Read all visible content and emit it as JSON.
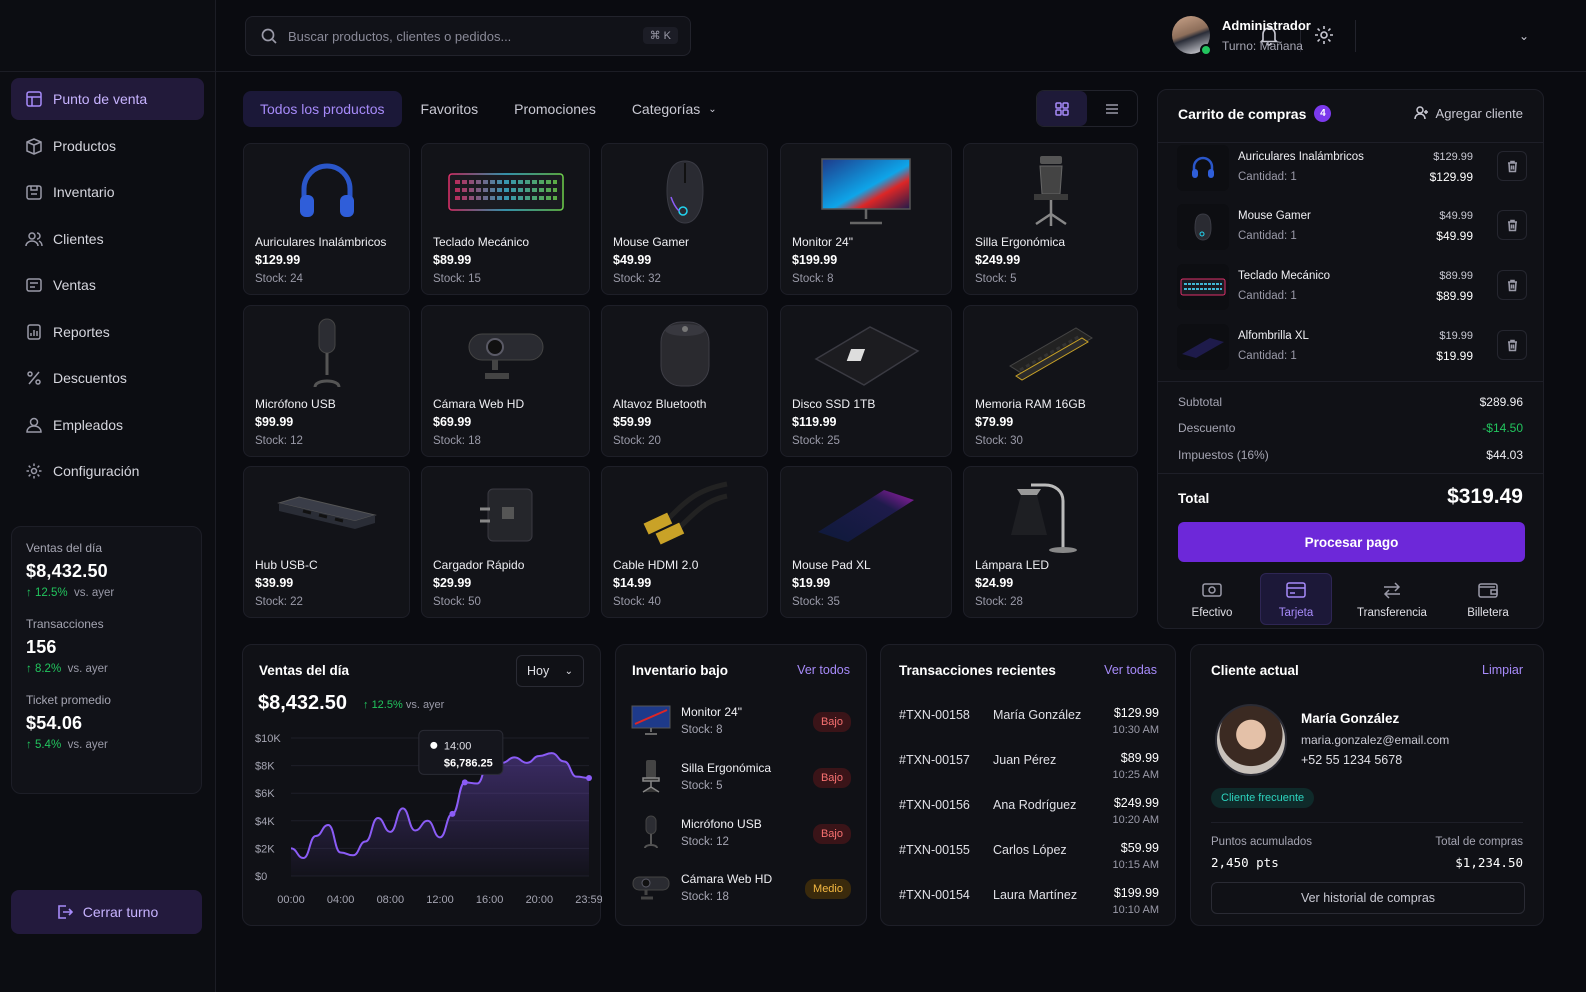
{
  "sidebar": {
    "items": [
      {
        "label": "Punto de venta",
        "icon": "pos-icon"
      },
      {
        "label": "Productos",
        "icon": "box-icon"
      },
      {
        "label": "Inventario",
        "icon": "inventory-icon"
      },
      {
        "label": "Clientes",
        "icon": "users-icon"
      },
      {
        "label": "Ventas",
        "icon": "sales-icon"
      },
      {
        "label": "Reportes",
        "icon": "report-icon"
      },
      {
        "label": "Descuentos",
        "icon": "percent-icon"
      },
      {
        "label": "Empleados",
        "icon": "employee-icon"
      },
      {
        "label": "Configuración",
        "icon": "gear-icon"
      }
    ],
    "stats": [
      {
        "label": "Ventas del día",
        "value": "$8,432.50",
        "change": "12.5%",
        "suffix": "vs. ayer"
      },
      {
        "label": "Transacciones",
        "value": "156",
        "change": "8.2%",
        "suffix": "vs. ayer"
      },
      {
        "label": "Ticket promedio",
        "value": "$54.06",
        "change": "5.4%",
        "suffix": "vs. ayer"
      }
    ],
    "logout": "Cerrar turno"
  },
  "topbar": {
    "search_placeholder": "Buscar productos, clientes o pedidos...",
    "shortcut": "⌘  K",
    "user_name": "Administrador",
    "user_shift": "Turno: Mañana"
  },
  "tabs": [
    "Todos los productos",
    "Favoritos",
    "Promociones",
    "Categorías"
  ],
  "products": [
    {
      "name": "Auriculares Inalámbricos",
      "price": "$129.99",
      "stock": "Stock: 24",
      "icon": "headphones-icon"
    },
    {
      "name": "Teclado Mecánico",
      "price": "$89.99",
      "stock": "Stock: 15",
      "icon": "keyboard-icon"
    },
    {
      "name": "Mouse Gamer",
      "price": "$49.99",
      "stock": "Stock: 32",
      "icon": "mouse-icon"
    },
    {
      "name": "Monitor 24\"",
      "price": "$199.99",
      "stock": "Stock: 8",
      "icon": "monitor-icon"
    },
    {
      "name": "Silla Ergonómica",
      "price": "$249.99",
      "stock": "Stock: 5",
      "icon": "chair-icon"
    },
    {
      "name": "Micrófono USB",
      "price": "$99.99",
      "stock": "Stock: 12",
      "icon": "microphone-icon"
    },
    {
      "name": "Cámara Web HD",
      "price": "$69.99",
      "stock": "Stock: 18",
      "icon": "webcam-icon"
    },
    {
      "name": "Altavoz Bluetooth",
      "price": "$59.99",
      "stock": "Stock: 20",
      "icon": "speaker-icon"
    },
    {
      "name": "Disco SSD 1TB",
      "price": "$119.99",
      "stock": "Stock: 25",
      "icon": "ssd-icon"
    },
    {
      "name": "Memoria RAM 16GB",
      "price": "$79.99",
      "stock": "Stock: 30",
      "icon": "ram-icon"
    },
    {
      "name": "Hub USB-C",
      "price": "$39.99",
      "stock": "Stock: 22",
      "icon": "usb-hub-icon"
    },
    {
      "name": "Cargador Rápido",
      "price": "$29.99",
      "stock": "Stock: 50",
      "icon": "charger-icon"
    },
    {
      "name": "Cable HDMI 2.0",
      "price": "$14.99",
      "stock": "Stock: 40",
      "icon": "hdmi-cable-icon"
    },
    {
      "name": "Mouse Pad XL",
      "price": "$19.99",
      "stock": "Stock: 35",
      "icon": "mousepad-icon"
    },
    {
      "name": "Lámpara LED",
      "price": "$24.99",
      "stock": "Stock: 28",
      "icon": "lamp-icon"
    }
  ],
  "cart": {
    "title": "Carrito de compras",
    "count": "4",
    "add_client": "Agregar cliente",
    "items": [
      {
        "name": "Auriculares Inalámbricos",
        "qty": "Cantidad: 1",
        "unit": "$129.99",
        "total": "$129.99",
        "icon": "headphones-icon"
      },
      {
        "name": "Mouse Gamer",
        "qty": "Cantidad: 1",
        "unit": "$49.99",
        "total": "$49.99",
        "icon": "mouse-icon"
      },
      {
        "name": "Teclado Mecánico",
        "qty": "Cantidad: 1",
        "unit": "$89.99",
        "total": "$89.99",
        "icon": "keyboard-icon"
      },
      {
        "name": "Alfombrilla XL",
        "qty": "Cantidad: 1",
        "unit": "$19.99",
        "total": "$19.99",
        "icon": "mousepad-icon"
      }
    ],
    "subtotal_label": "Subtotal",
    "subtotal": "$289.96",
    "discount_label": "Descuento",
    "discount": "-$14.50",
    "tax_label": "Impuestos (16%)",
    "tax": "$44.03",
    "total_label": "Total",
    "total": "$319.49",
    "pay_button": "Procesar pago",
    "methods": [
      "Efectivo",
      "Tarjeta",
      "Transferencia",
      "Billetera"
    ]
  },
  "sales_panel": {
    "title": "Ventas del día",
    "period": "Hoy",
    "value": "$8,432.50",
    "change": "12.5%",
    "suffix": "vs. ayer",
    "tooltip_time": "14:00",
    "tooltip_value": "$6,786.25"
  },
  "chart_data": {
    "type": "area",
    "x": [
      "00:00",
      "01:00",
      "02:00",
      "03:00",
      "04:00",
      "05:00",
      "06:00",
      "07:00",
      "08:00",
      "09:00",
      "10:00",
      "11:00",
      "12:00",
      "13:00",
      "14:00",
      "15:00",
      "16:00",
      "17:00",
      "18:00",
      "19:00",
      "20:00",
      "21:00",
      "22:00",
      "23:00",
      "23:59"
    ],
    "values": [
      2000,
      1300,
      2900,
      3700,
      1700,
      1500,
      2500,
      4200,
      3200,
      4900,
      3300,
      4000,
      2800,
      4500,
      6786,
      6700,
      8500,
      8200,
      8600,
      8200,
      8700,
      8900,
      8300,
      7200,
      7100
    ],
    "ylim": [
      0,
      10000
    ],
    "yticks": [
      "$10K",
      "$8K",
      "$6K",
      "$4K",
      "$2K",
      "$0"
    ],
    "xticks": [
      "00:00",
      "04:00",
      "08:00",
      "12:00",
      "16:00",
      "20:00",
      "23:59"
    ],
    "color": "#8b5cf6"
  },
  "low_inventory": {
    "title": "Inventario bajo",
    "link": "Ver todos",
    "items": [
      {
        "name": "Monitor 24\"",
        "stock": "Stock: 8",
        "level": "Bajo",
        "icon": "monitor-icon"
      },
      {
        "name": "Silla Ergonómica",
        "stock": "Stock: 5",
        "level": "Bajo",
        "icon": "chair-icon"
      },
      {
        "name": "Micrófono USB",
        "stock": "Stock: 12",
        "level": "Bajo",
        "icon": "microphone-icon"
      },
      {
        "name": "Cámara Web HD",
        "stock": "Stock: 18",
        "level": "Medio",
        "icon": "webcam-icon"
      }
    ]
  },
  "transactions": {
    "title": "Transacciones recientes",
    "link": "Ver todas",
    "items": [
      {
        "id": "#TXN-00158",
        "client": "María González",
        "amount": "$129.99",
        "time": "10:30 AM"
      },
      {
        "id": "#TXN-00157",
        "client": "Juan Pérez",
        "amount": "$89.99",
        "time": "10:25 AM"
      },
      {
        "id": "#TXN-00156",
        "client": "Ana Rodríguez",
        "amount": "$249.99",
        "time": "10:20 AM"
      },
      {
        "id": "#TXN-00155",
        "client": "Carlos López",
        "amount": "$59.99",
        "time": "10:15 AM"
      },
      {
        "id": "#TXN-00154",
        "client": "Laura Martínez",
        "amount": "$199.99",
        "time": "10:10 AM"
      }
    ]
  },
  "client": {
    "title": "Cliente actual",
    "clear": "Limpiar",
    "name": "María González",
    "email": "maria.gonzalez@email.com",
    "phone": "+52 55 1234 5678",
    "tag": "Cliente frecuente",
    "points_label": "Puntos acumulados",
    "points": "2,450 pts",
    "total_label": "Total de compras",
    "total": "$1,234.50",
    "history_button": "Ver historial de compras"
  }
}
